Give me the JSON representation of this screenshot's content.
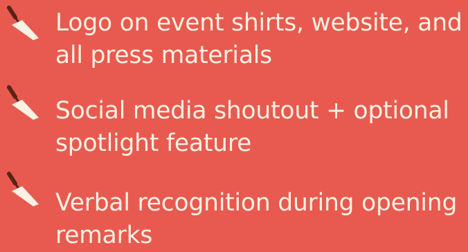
{
  "colors": {
    "background": "#e85a4f",
    "text": "#fbf1e4",
    "trowel_blade": "#fbf1e4",
    "trowel_handle": "#5a2318"
  },
  "benefits": {
    "items": [
      {
        "icon": "trowel-icon",
        "text": "Logo on event shirts, website, and all press materials"
      },
      {
        "icon": "trowel-icon",
        "text": "Social media shoutout + optional spotlight feature"
      },
      {
        "icon": "trowel-icon",
        "text": "Verbal recognition during opening remarks"
      }
    ]
  }
}
